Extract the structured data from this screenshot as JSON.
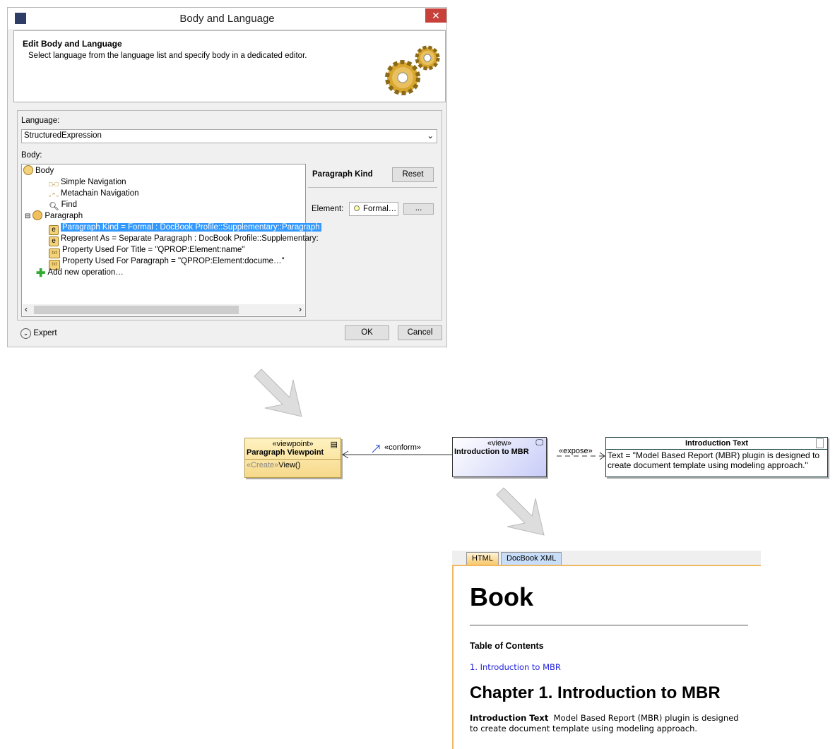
{
  "dialog": {
    "title": "Body and Language",
    "close": "✕",
    "header_title": "Edit Body and Language",
    "header_desc": "Select language from the language list and specify body in a dedicated editor.",
    "language_label": "Language:",
    "language_value": "StructuredExpression",
    "body_label": "Body:",
    "tree": [
      {
        "label": "Body",
        "icon": "body-icon"
      },
      {
        "label": "Simple Navigation",
        "icon": "simple-navigation-icon"
      },
      {
        "label": "Metachain Navigation",
        "icon": "metachain-icon"
      },
      {
        "label": "Find",
        "icon": "find-icon"
      },
      {
        "label": "Paragraph",
        "icon": "paragraph-icon"
      },
      {
        "label": "Paragraph Kind = Formal : DocBook Profile::Supplementary::Paragraph",
        "icon": "enum-icon"
      },
      {
        "label": "Represent As = Separate Paragraph : DocBook Profile::Supplementary:",
        "icon": "enum-icon"
      },
      {
        "label": "Property Used For Title = \"QPROP:Element:name\"",
        "icon": "txt-icon"
      },
      {
        "label": "Property Used For Paragraph = \"QPROP:Element:docume…\"",
        "icon": "txt-icon"
      },
      {
        "label": "Add new operation…",
        "icon": "plus-icon"
      }
    ],
    "prop_title": "Paragraph Kind",
    "reset": "Reset",
    "element_label": "Element:",
    "element_value": "Formal…",
    "browse": "...",
    "expert": "Expert",
    "ok": "OK",
    "cancel": "Cancel",
    "txt": "txt",
    "enum": "e"
  },
  "diagram": {
    "viewpoint_stereo": "«viewpoint»",
    "viewpoint_name": "Paragraph Viewpoint",
    "create_stereo": "«Create»",
    "view_op": "View()",
    "conform": "«conform»",
    "view_stereo": "«view»",
    "view_name": "Introduction to MBR",
    "expose": "«expose»",
    "it_title": "Introduction Text",
    "it_text": "Text = \"Model Based Report (MBR) plugin is designed to create document template using modeling approach.\""
  },
  "doc": {
    "tabs": [
      "HTML",
      "DocBook XML"
    ],
    "book": "Book",
    "toc": "Table of Contents",
    "toc_item": "1. Introduction to MBR",
    "chapter": "Chapter 1. Introduction to MBR",
    "para_label": "Introduction Text",
    "para_text": "Model Based Report (MBR) plugin is designed to create document template using modeling approach."
  }
}
